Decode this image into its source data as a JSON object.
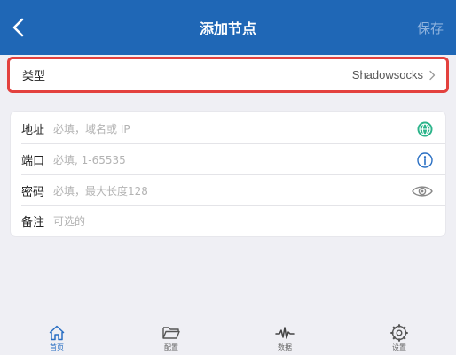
{
  "header": {
    "title": "添加节点",
    "save_label": "保存"
  },
  "type_row": {
    "label": "类型",
    "value": "Shadowsocks"
  },
  "form": {
    "address": {
      "label": "地址",
      "placeholder": "必填，域名或 IP",
      "icon": "globe-icon"
    },
    "port": {
      "label": "端口",
      "placeholder": "必填, 1-65535",
      "icon": "info-icon"
    },
    "password": {
      "label": "密码",
      "placeholder": "必填，最大长度128",
      "icon": "eye-icon"
    },
    "remark": {
      "label": "备注",
      "placeholder": "可选的"
    }
  },
  "tabs": [
    {
      "label": "首页",
      "icon": "home-icon",
      "active": true
    },
    {
      "label": "配置",
      "icon": "folder-icon",
      "active": false
    },
    {
      "label": "数据",
      "icon": "waveform-icon",
      "active": false
    },
    {
      "label": "设置",
      "icon": "gear-icon",
      "active": false
    }
  ],
  "colors": {
    "header_bg": "#1f67b6",
    "highlight_border": "#e3413e",
    "globe_icon": "#2bb48a",
    "info_icon": "#2a6fc3",
    "active_tab": "#2a6fc3"
  }
}
